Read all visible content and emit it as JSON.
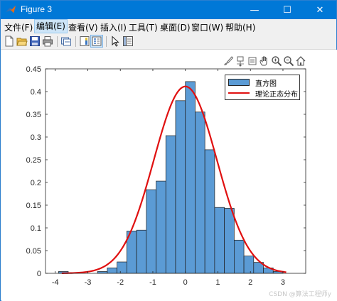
{
  "window": {
    "title": "Figure 3",
    "minimize_label": "—",
    "maximize_label": "☐",
    "close_label": "✕"
  },
  "menu": {
    "items": [
      "文件(F)",
      "编辑(E)",
      "查看(V)",
      "插入(I)",
      "工具(T)",
      "桌面(D)",
      "窗口(W)",
      "帮助(H)"
    ],
    "active_index": 1
  },
  "toolbar": {
    "icons": [
      "new-figure-icon",
      "open-file-icon",
      "save-icon",
      "print-icon",
      "link-icon",
      "colorbar-icon",
      "legend-icon",
      "edit-plot-arrow-icon",
      "property-inspector-icon"
    ]
  },
  "axes_toolbar": {
    "icons": [
      "brush-icon",
      "data-tips-icon",
      "rotate-icon",
      "pan-hand-icon",
      "zoom-in-icon",
      "zoom-out-icon",
      "home-icon"
    ]
  },
  "chart_data": {
    "type": "bar",
    "title": "",
    "xlabel": "",
    "ylabel": "",
    "xlim": [
      -4.3,
      3.7
    ],
    "ylim": [
      0,
      0.45
    ],
    "xticks": [
      -4,
      -3,
      -2,
      -1,
      0,
      1,
      2,
      3
    ],
    "yticks": [
      0,
      0.05,
      0.1,
      0.15,
      0.2,
      0.25,
      0.3,
      0.35,
      0.4,
      0.45
    ],
    "xtick_labels": [
      "-4",
      "-3",
      "-2",
      "-1",
      "0",
      "1",
      "2",
      "3"
    ],
    "ytick_labels": [
      "0",
      "0.05",
      "0.1",
      "0.15",
      "0.2",
      "0.25",
      "0.3",
      "0.35",
      "0.4",
      "0.45"
    ],
    "bar_color": "#5b9bd5",
    "curve_color": "#e01010",
    "grid": false,
    "legend_position": "top-right",
    "bin_width": 0.3,
    "bins": [
      {
        "x0": -3.9,
        "value": 0.004
      },
      {
        "x0": -3.6,
        "value": 0.0
      },
      {
        "x0": -3.3,
        "value": 0.0
      },
      {
        "x0": -3.0,
        "value": 0.0
      },
      {
        "x0": -2.7,
        "value": 0.004
      },
      {
        "x0": -2.4,
        "value": 0.012
      },
      {
        "x0": -2.1,
        "value": 0.025
      },
      {
        "x0": -1.8,
        "value": 0.093
      },
      {
        "x0": -1.5,
        "value": 0.095
      },
      {
        "x0": -1.2,
        "value": 0.184
      },
      {
        "x0": -0.9,
        "value": 0.203
      },
      {
        "x0": -0.6,
        "value": 0.303
      },
      {
        "x0": -0.3,
        "value": 0.38
      },
      {
        "x0": 0.0,
        "value": 0.422
      },
      {
        "x0": 0.3,
        "value": 0.355
      },
      {
        "x0": 0.6,
        "value": 0.272
      },
      {
        "x0": 0.9,
        "value": 0.145
      },
      {
        "x0": 1.2,
        "value": 0.143
      },
      {
        "x0": 1.5,
        "value": 0.073
      },
      {
        "x0": 1.8,
        "value": 0.038
      },
      {
        "x0": 2.1,
        "value": 0.024
      },
      {
        "x0": 2.4,
        "value": 0.012
      },
      {
        "x0": 2.7,
        "value": 0.004
      }
    ],
    "series": [
      {
        "name": "直方图",
        "kind": "histogram"
      },
      {
        "name": "理论正态分布",
        "kind": "curve",
        "mean": 0,
        "std": 0.97,
        "x_range": [
          -3.8,
          3.1
        ]
      }
    ]
  },
  "watermark": "CSDN @算法工程师y"
}
